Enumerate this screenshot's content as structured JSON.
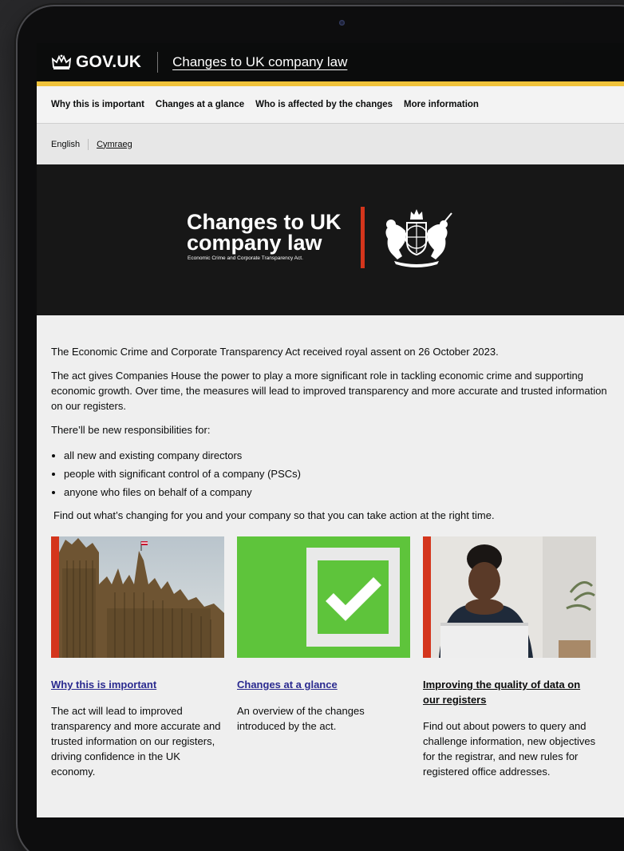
{
  "header": {
    "logo_text": "GOV.UK",
    "service_name": "Changes to UK company law"
  },
  "nav": {
    "items": [
      {
        "label": "Why this is important"
      },
      {
        "label": "Changes at a glance"
      },
      {
        "label": "Who is affected by the changes"
      },
      {
        "label": "More information"
      }
    ]
  },
  "language": {
    "current": "English",
    "alternate": "Cymraeg"
  },
  "hero": {
    "title_line1": "Changes to UK",
    "title_line2": "company law",
    "subtitle": "Economic Crime and Corporate Transparency Act."
  },
  "content": {
    "para1": "The Economic Crime and Corporate Transparency Act received royal assent on 26 October 2023.",
    "para2": "The act gives Companies House the power to play a more significant role in tackling economic crime and supporting economic growth. Over time, the measures will lead to improved transparency and more accurate and trusted information on our registers.",
    "para3": "There’ll be new responsibilities for:",
    "bullets": [
      "all new and existing company directors",
      "people with significant control of a company (PSCs)",
      "anyone who files on behalf of a company"
    ],
    "para4": "Find out what’s changing for you and your company so that you can take action at the right time."
  },
  "cards": [
    {
      "title": "Why this is important",
      "description": "The act will lead to improved transparency and more accurate and trusted information on our registers, driving confidence in the UK economy."
    },
    {
      "title": "Changes at a glance",
      "description": "An overview of the changes introduced by the act."
    },
    {
      "title": "Improving the quality of data on our registers",
      "description": "Find out about powers to query and challenge information, new objectives for the registrar, and new rules for registered office addresses."
    }
  ],
  "colors": {
    "header_bg": "#0b0c0c",
    "header_stripe": "#f0c23a",
    "hero_bg": "#171717",
    "accent_red": "#d4351c",
    "card_green": "#5ec43b",
    "link_blue": "#2a2a8f"
  }
}
